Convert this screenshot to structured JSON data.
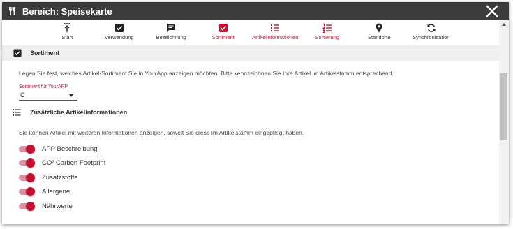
{
  "dialog": {
    "title": "Bereich: Speisekarte",
    "title_icon": "fork-knife-icon",
    "close_icon": "close-icon"
  },
  "steps": [
    {
      "label": "Start",
      "icon": "upload-icon",
      "active": false
    },
    {
      "label": "Verwendung",
      "icon": "checkbox-icon",
      "active": false
    },
    {
      "label": "Bezeichnung",
      "icon": "message-icon",
      "active": false
    },
    {
      "label": "Sortiment",
      "icon": "checkbox-icon",
      "active": true
    },
    {
      "label": "Artikelinformationen",
      "icon": "list-icon",
      "active": true
    },
    {
      "label": "Sortierung",
      "icon": "ordered-list-icon",
      "active": true
    },
    {
      "label": "Standorte",
      "icon": "location-pin-icon",
      "active": false
    },
    {
      "label": "Synchronisation",
      "icon": "sync-icon",
      "active": false
    }
  ],
  "sortiment": {
    "heading": "Sortiment",
    "description": "Legen Sie fest, welches Artikel-Sortiment Sie in YourApp anzeigen möchten. Bitte kennzeichnen Sie Ihre Artikel im Artikelstamm entsprechend.",
    "field_label": "Sortiment für YourAPP",
    "field_value": "C"
  },
  "info": {
    "heading": "Zusätzliche Artikelinformationen",
    "description": "Sie können Artikel mit weiteren Informationen anzeigen, soweit Sie diese im Artikelstamm eingepflegt haben.",
    "toggles": [
      {
        "label": "APP Beschreibung",
        "on": true
      },
      {
        "label": "CO² Carbon Footprint",
        "on": true
      },
      {
        "label": "Zusatzstoffe",
        "on": true
      },
      {
        "label": "Allergene",
        "on": true
      },
      {
        "label": "Nährwerte",
        "on": true
      }
    ]
  },
  "colors": {
    "accent": "#c8102e",
    "titlebar": "#3c3c3c",
    "section_bg": "#efefef"
  }
}
